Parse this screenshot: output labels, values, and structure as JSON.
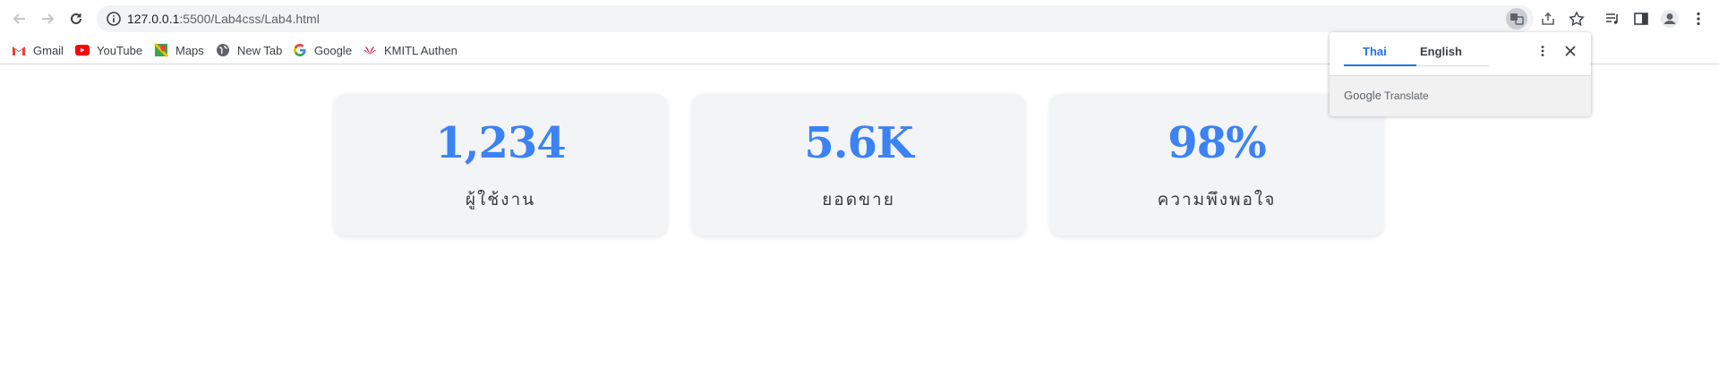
{
  "browser": {
    "url_host": "127.0.0.1",
    "url_path": ":5500/Lab4css/Lab4.html"
  },
  "bookmarks": [
    {
      "label": "Gmail",
      "icon": "gmail-icon"
    },
    {
      "label": "YouTube",
      "icon": "youtube-icon"
    },
    {
      "label": "Maps",
      "icon": "maps-icon"
    },
    {
      "label": "New Tab",
      "icon": "globe-icon"
    },
    {
      "label": "Google",
      "icon": "google-icon"
    },
    {
      "label": "KMITL Authen",
      "icon": "huawei-icon"
    }
  ],
  "stats": [
    {
      "value": "1,234",
      "label": "ผู้ใช้งาน"
    },
    {
      "value": "5.6K",
      "label": "ยอดขาย"
    },
    {
      "value": "98%",
      "label": "ความพึงพอใจ"
    }
  ],
  "translate_popup": {
    "tab_source": "Thai",
    "tab_target": "English",
    "brand_google": "Google",
    "brand_translate": "Translate"
  },
  "colors": {
    "stat_value": "#3b82f6",
    "card_bg": "#f3f4f6",
    "accent_tab": "#1a73e8"
  }
}
